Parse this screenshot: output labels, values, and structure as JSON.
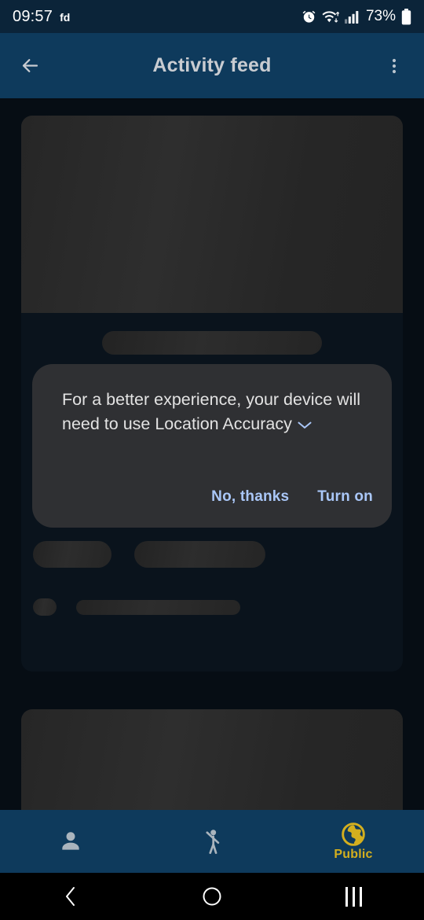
{
  "status_bar": {
    "time": "09:57",
    "carrier_tag": "fd",
    "battery_percent": "73%",
    "icons": [
      "alarm-icon",
      "wifi-icon",
      "cellular-signal-icon",
      "battery-icon"
    ]
  },
  "app_bar": {
    "back_icon": "arrow-left-icon",
    "title": "Activity feed",
    "overflow_icon": "more-vertical-icon",
    "background_color": "#0e3a5c"
  },
  "feed": {
    "cards": [
      {
        "name": "activity-card-1",
        "state": "loading"
      },
      {
        "name": "activity-card-2",
        "state": "loading"
      }
    ]
  },
  "dialog": {
    "message": "For a better experience, your device will need to use Location Accuracy",
    "expand_icon": "chevron-down-icon",
    "decline_label": "No, thanks",
    "confirm_label": "Turn on",
    "background_color": "#2f3033",
    "action_color": "#aac7f8"
  },
  "bottom_nav": {
    "items": [
      {
        "label": "",
        "icon": "person-icon",
        "active": false
      },
      {
        "label": "",
        "icon": "waving-person-icon",
        "active": false
      },
      {
        "label": "Public",
        "icon": "globe-icon",
        "active": true
      }
    ],
    "active_color": "#d4af1e",
    "inactive_color": "#aab4bd"
  },
  "android_nav": {
    "back_icon": "nav-back-icon",
    "home_icon": "nav-home-icon",
    "recents_icon": "nav-recents-icon"
  }
}
